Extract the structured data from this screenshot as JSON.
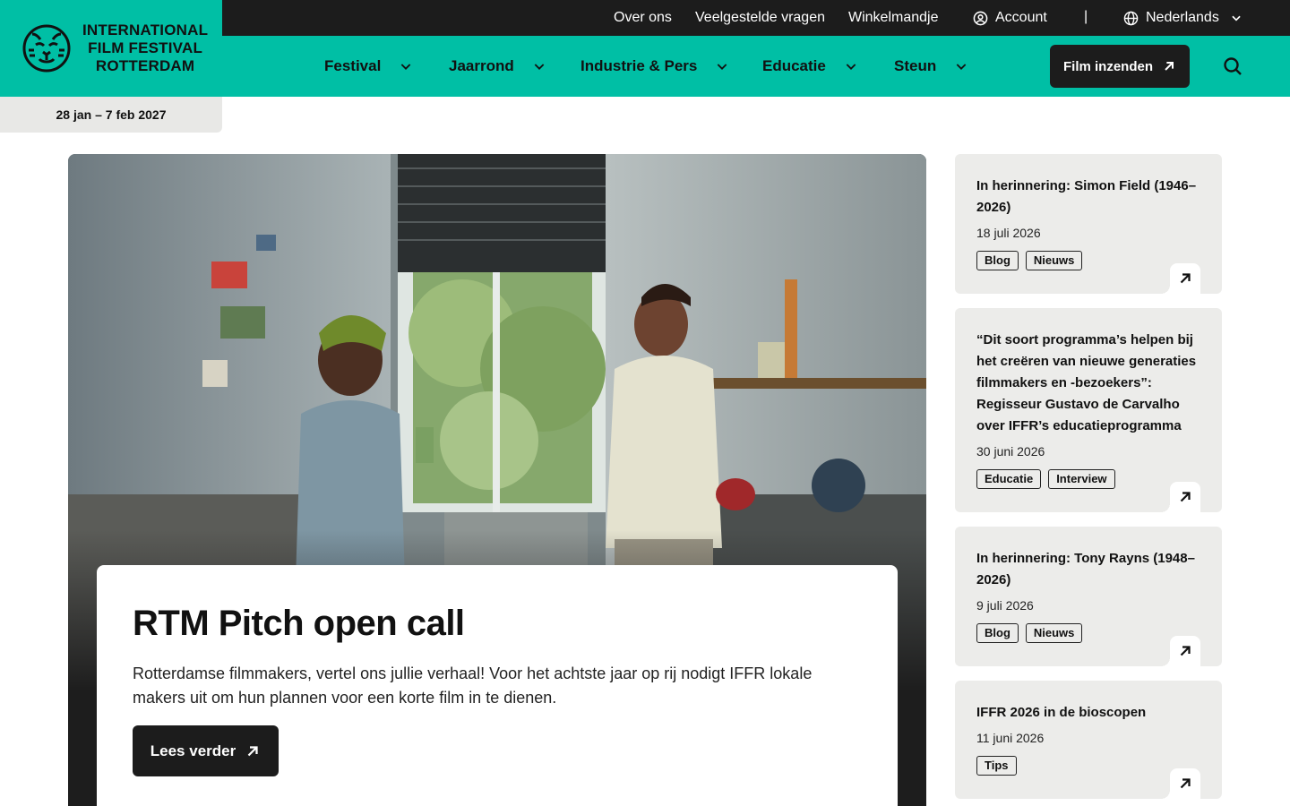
{
  "topbar": {
    "links": [
      "Over ons",
      "Veelgestelde vragen",
      "Winkelmandje"
    ],
    "account": "Account",
    "separator": "|",
    "language": "Nederlands"
  },
  "logo": {
    "line1": "INTERNATIONAL",
    "line2": "FILM FESTIVAL",
    "line3": "ROTTERDAM"
  },
  "nav": {
    "items": [
      "Festival",
      "Jaarrond",
      "Industrie & Pers",
      "Educatie",
      "Steun"
    ],
    "submit_label": "Film inzenden"
  },
  "festival_dates": "28 jan – 7 feb 2027",
  "hero": {
    "title": "RTM Pitch open call",
    "text": "Rotterdamse filmmakers, vertel ons jullie verhaal! Voor het achtste jaar op rij nodigt IFFR lokale makers uit om hun plannen voor een korte film in te dienen.",
    "button": "Lees verder"
  },
  "cards": [
    {
      "title": "In herinnering: Simon Field (1946–2026)",
      "date": "18 juli 2026",
      "tags": [
        "Blog",
        "Nieuws"
      ]
    },
    {
      "title": "“Dit soort programma’s helpen bij het creëren van nieuwe generaties filmmakers en -bezoekers”: Regisseur Gustavo de Carvalho over IFFR’s educatieprogramma",
      "date": "30 juni 2026",
      "tags": [
        "Educatie",
        "Interview"
      ]
    },
    {
      "title": "In herinnering: Tony Rayns (1948–2026)",
      "date": "9 juli 2026",
      "tags": [
        "Blog",
        "Nieuws"
      ]
    },
    {
      "title": "IFFR 2026 in de bioscopen",
      "date": "11 juni 2026",
      "tags": [
        "Tips"
      ]
    }
  ],
  "colors": {
    "brand": "#00bfa5",
    "dark": "#1c1c1c",
    "card": "#ececea"
  }
}
